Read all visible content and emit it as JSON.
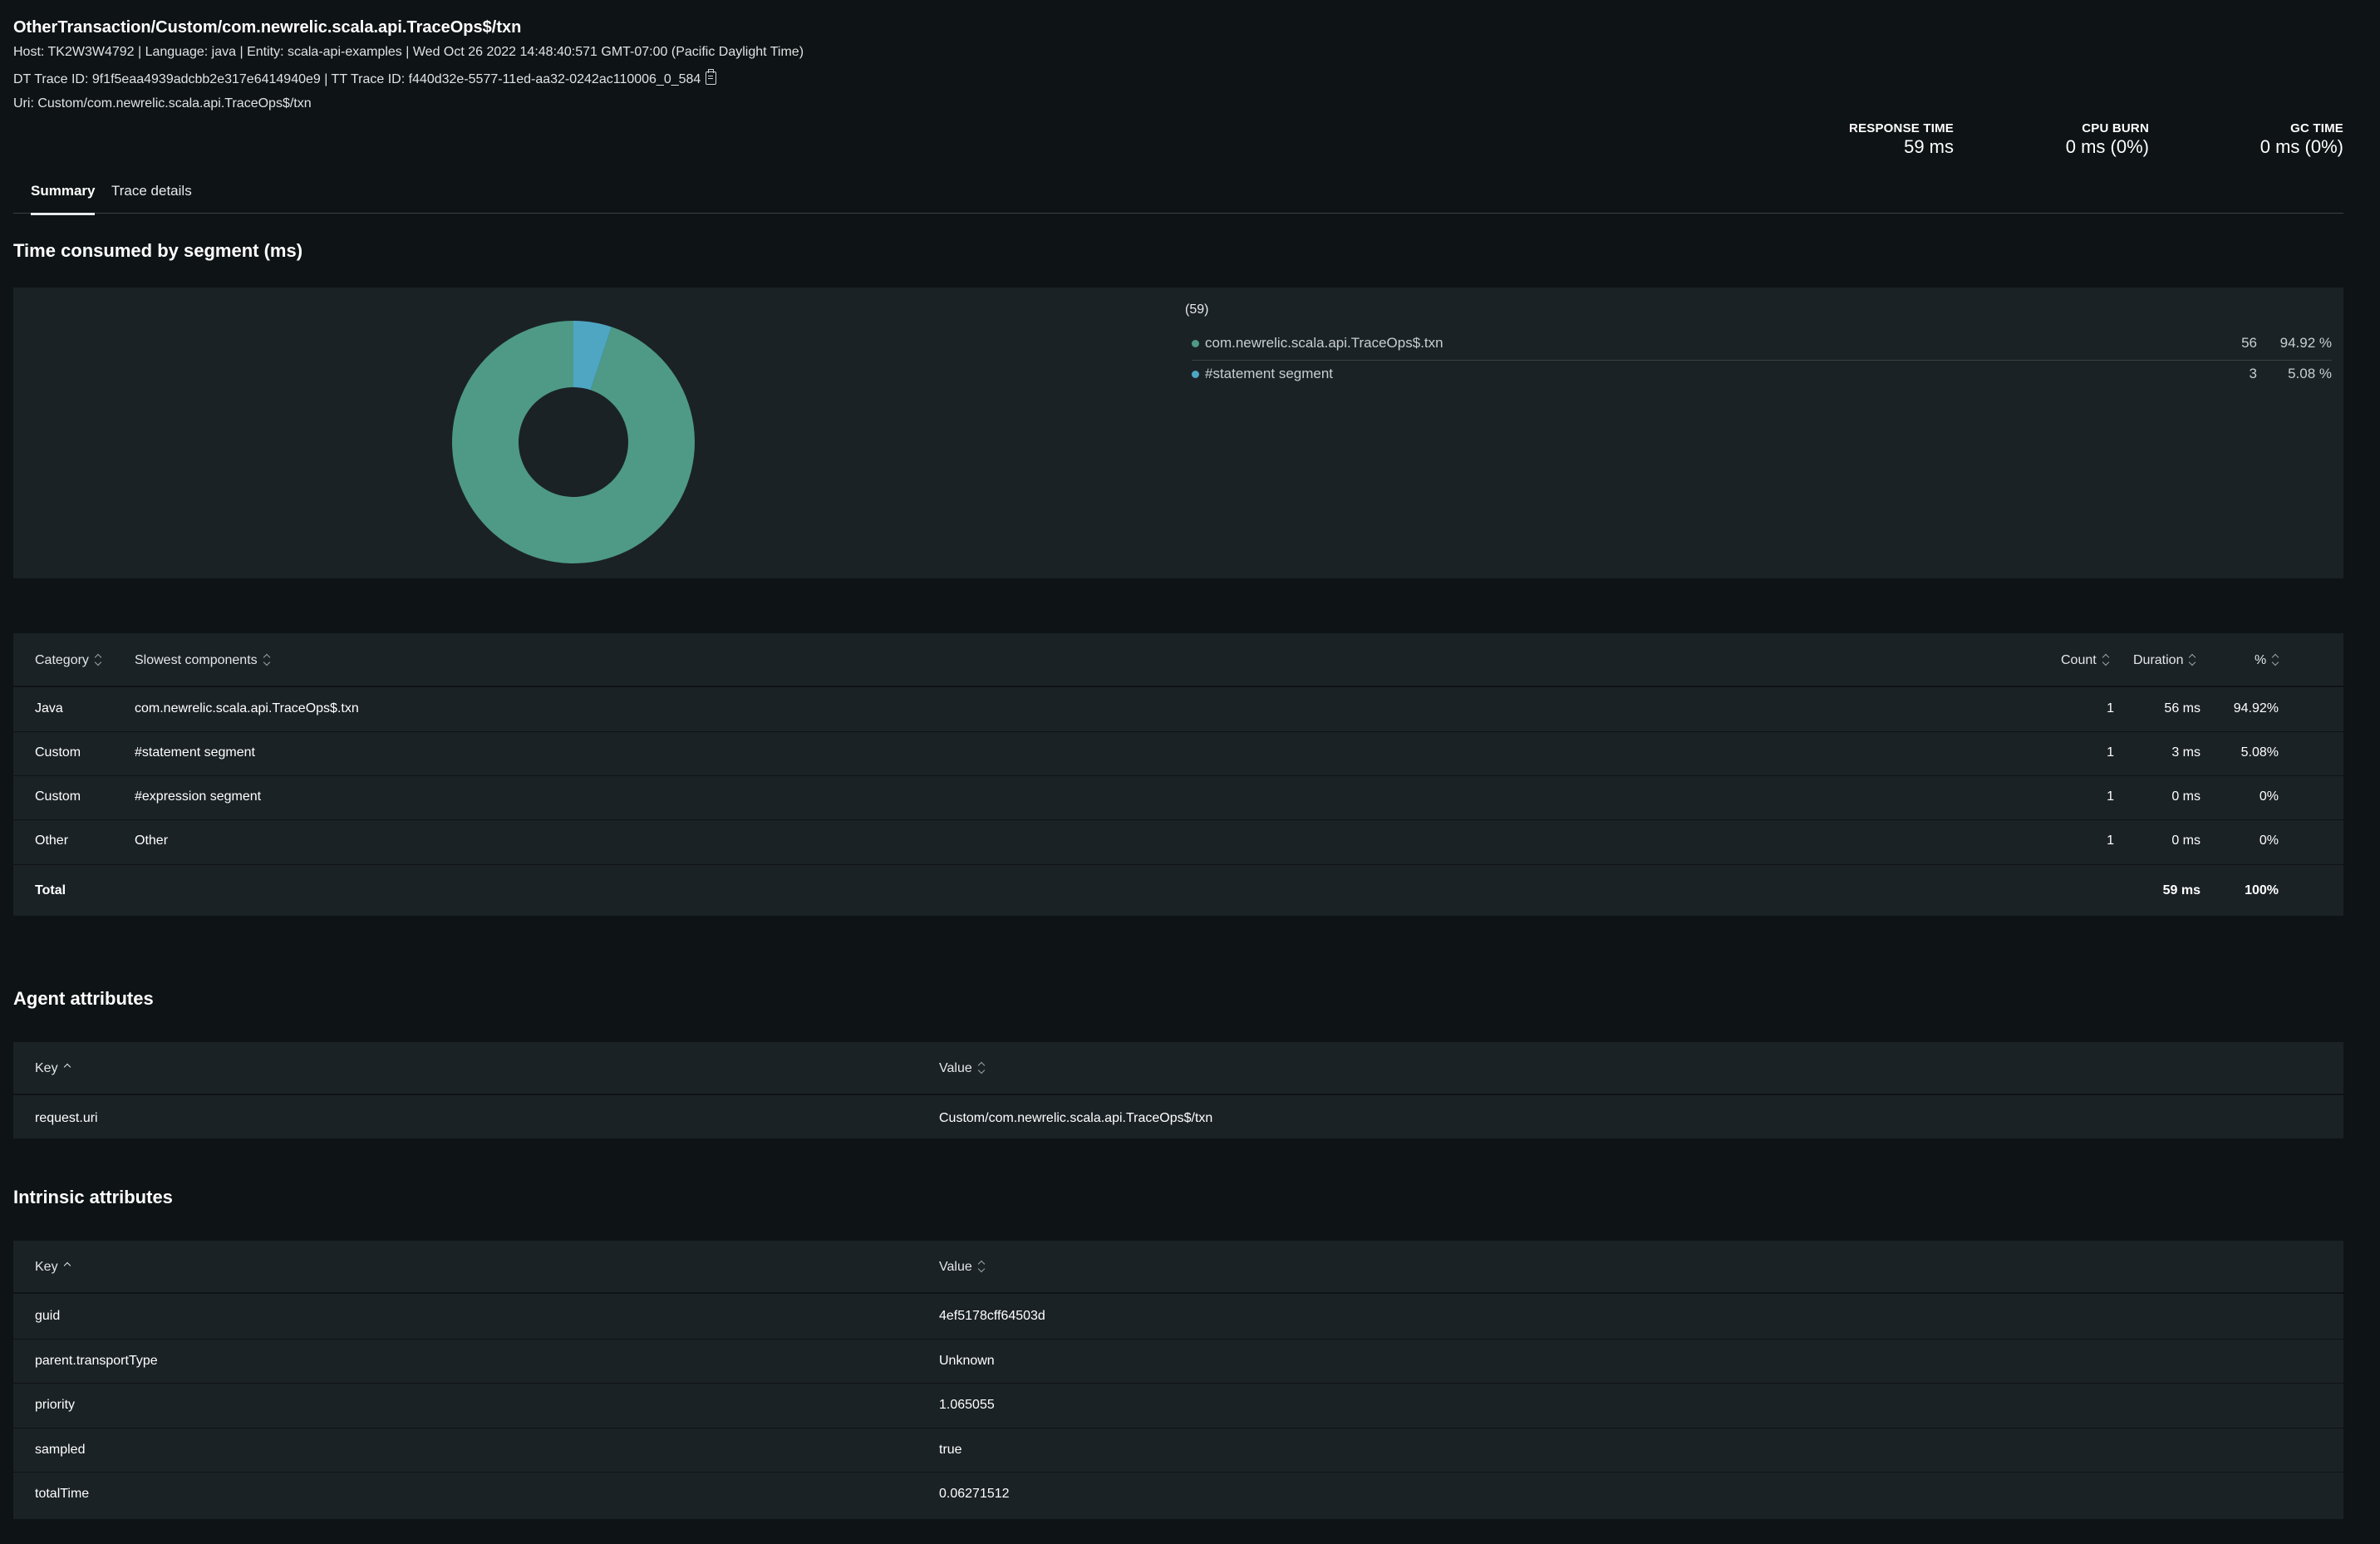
{
  "header": {
    "title": "OtherTransaction/Custom/com.newrelic.scala.api.TraceOps$/txn",
    "host_line": "Host: TK2W3W4792 | Language: java | Entity: scala-api-examples | Wed Oct 26 2022 14:48:40:571 GMT-07:00 (Pacific Daylight Time)",
    "trace_line": "DT Trace ID: 9f1f5eaa4939adcbb2e317e6414940e9 | TT Trace ID: f440d32e-5577-11ed-aa32-0242ac110006_0_584",
    "uri_line": "Uri: Custom/com.newrelic.scala.api.TraceOps$/txn",
    "copy_icon": "clipboard-icon"
  },
  "metrics": [
    {
      "label": "RESPONSE TIME",
      "value": "59 ms"
    },
    {
      "label": "CPU BURN",
      "value": "0 ms (0%)"
    },
    {
      "label": "GC TIME",
      "value": "0 ms (0%)"
    }
  ],
  "tabs": [
    {
      "label": "Summary",
      "active": true
    },
    {
      "label": "Trace details",
      "active": false
    }
  ],
  "segments": {
    "heading": "Time consumed by segment (ms)",
    "total_label": "(59)",
    "legend": [
      {
        "name": "com.newrelic.scala.api.TraceOps$.txn",
        "value": "56",
        "percent": "94.92 %",
        "color": "#4e9a86"
      },
      {
        "name": "#statement segment",
        "value": "3",
        "percent": "5.08 %",
        "color": "#4ea6c3"
      }
    ]
  },
  "chart_data": {
    "type": "pie",
    "categories": [
      "com.newrelic.scala.api.TraceOps$.txn",
      "#statement segment"
    ],
    "values": [
      56,
      3
    ],
    "colors": [
      "#4e9a86",
      "#4ea6c3"
    ]
  },
  "components_table": {
    "columns": {
      "category": "Category",
      "slowest": "Slowest components",
      "count": "Count",
      "duration": "Duration",
      "percent": "%"
    },
    "rows": [
      {
        "category": "Java",
        "component": "com.newrelic.scala.api.TraceOps$.txn",
        "count": "1",
        "duration": "56 ms",
        "percent": "94.92%"
      },
      {
        "category": "Custom",
        "component": "#statement segment",
        "count": "1",
        "duration": "3 ms",
        "percent": "5.08%"
      },
      {
        "category": "Custom",
        "component": "#expression segment",
        "count": "1",
        "duration": "0 ms",
        "percent": "0%"
      },
      {
        "category": "Other",
        "component": "Other",
        "count": "1",
        "duration": "0 ms",
        "percent": "0%"
      }
    ],
    "total": {
      "label": "Total",
      "duration": "59 ms",
      "percent": "100%"
    }
  },
  "agent_attributes": {
    "heading": "Agent attributes",
    "key_header": "Key",
    "value_header": "Value",
    "rows": [
      {
        "key": "request.uri",
        "value": "Custom/com.newrelic.scala.api.TraceOps$/txn"
      }
    ]
  },
  "intrinsic_attributes": {
    "heading": "Intrinsic attributes",
    "key_header": "Key",
    "value_header": "Value",
    "rows": [
      {
        "key": "guid",
        "value": "4ef5178cff64503d"
      },
      {
        "key": "parent.transportType",
        "value": "Unknown"
      },
      {
        "key": "priority",
        "value": "1.065055"
      },
      {
        "key": "sampled",
        "value": "true"
      },
      {
        "key": "totalTime",
        "value": "0.06271512"
      }
    ]
  }
}
